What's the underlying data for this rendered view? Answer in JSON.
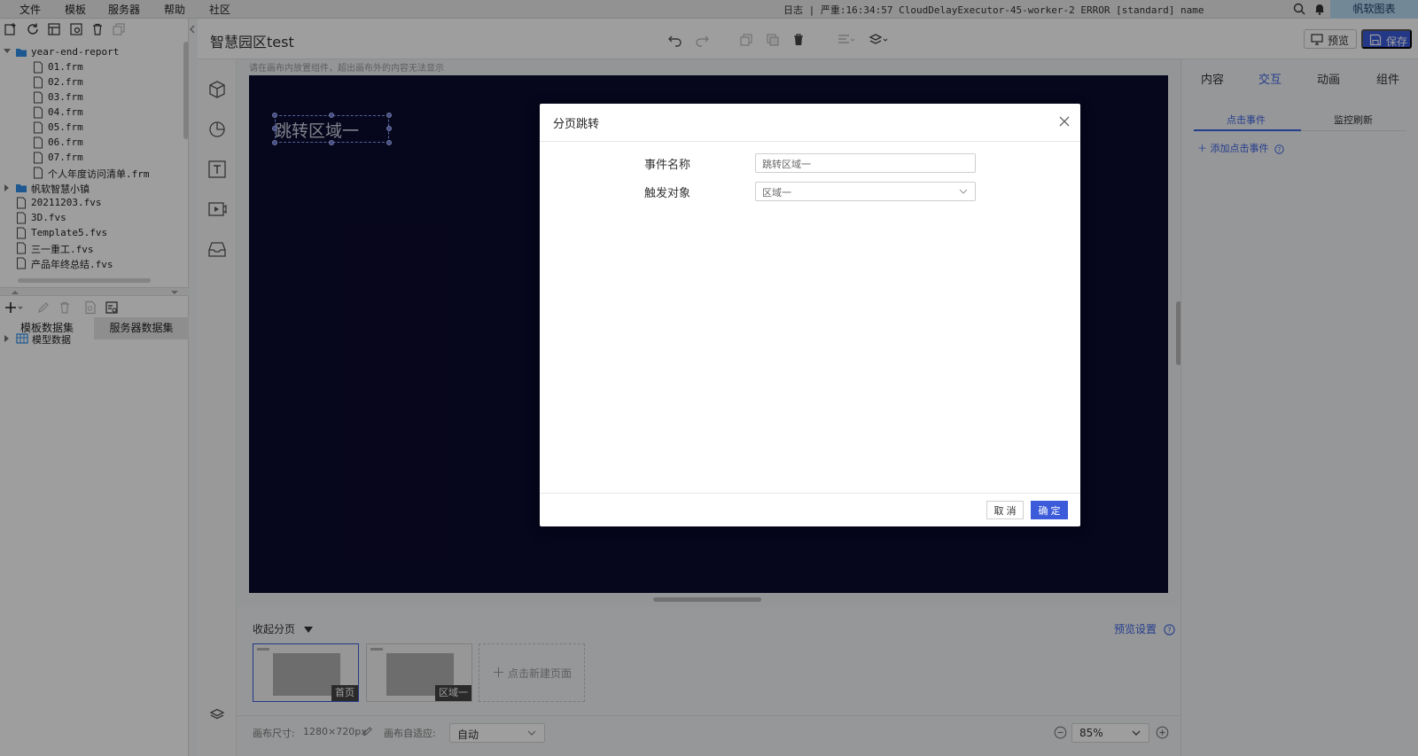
{
  "menubar": {
    "items": [
      "文件",
      "模板",
      "服务器",
      "帮助",
      "社区"
    ],
    "log": "日志 | 严重:16:34:57 CloudDelayExecutor-45-worker-2 ERROR [standard] name",
    "brand": "帆软图表"
  },
  "tree": {
    "folder1": "year-end-report",
    "files": [
      "01.frm",
      "02.frm",
      "03.frm",
      "04.frm",
      "05.frm",
      "06.frm",
      "07.frm",
      "个人年度访问清单.frm"
    ],
    "folder2": "帆软智慧小镇",
    "root_files": [
      "20211203.fvs",
      "3D.fvs",
      "Template5.fvs",
      "三一重工.fvs",
      "产品年终总结.fvs"
    ]
  },
  "datasets": {
    "tabs": [
      "模板数据集",
      "服务器数据集"
    ],
    "model": "模型数据"
  },
  "header": {
    "title": "智慧园区test",
    "preview": "预览",
    "save": "保存"
  },
  "canvas": {
    "hint": "请在画布内放置组件，超出画布外的内容无法显示",
    "selected_text": "跳转区域一"
  },
  "pages": {
    "collapse": "收起分页",
    "preview_settings": "预览设置",
    "thumb1": "首页",
    "thumb2": "区域一",
    "add": "点击新建页面"
  },
  "status": {
    "size_label": "画布尺寸:",
    "size_value": "1280×720px",
    "adapt_label": "画布自适应:",
    "adapt_value": "自动",
    "zoom": "85%"
  },
  "rightpanel": {
    "tabs": [
      "内容",
      "交互",
      "动画",
      "组件"
    ],
    "active_tab": "交互",
    "subtabs": [
      "点击事件",
      "监控刷新"
    ],
    "add_event": "添加点击事件"
  },
  "dialog": {
    "title": "分页跳转",
    "event_label": "事件名称",
    "event_value": "跳转区域一",
    "target_label": "触发对象",
    "target_value": "区域一",
    "cancel": "取 消",
    "ok": "确 定"
  },
  "colors": {
    "accent": "#3b5bdb",
    "canvas_bg": "#0b0a2e",
    "brand_bg": "#b8dcf4"
  }
}
